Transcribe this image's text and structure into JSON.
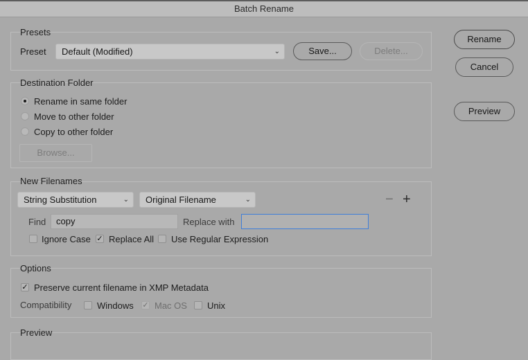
{
  "window": {
    "title": "Batch Rename"
  },
  "buttons": {
    "rename": "Rename",
    "cancel": "Cancel",
    "preview": "Preview"
  },
  "presets": {
    "legend": "Presets",
    "label": "Preset",
    "selected": "Default (Modified)",
    "save": "Save...",
    "delete": "Delete..."
  },
  "destination": {
    "legend": "Destination Folder",
    "options": [
      "Rename in same folder",
      "Move to other folder",
      "Copy to other folder"
    ],
    "selected_index": 0,
    "browse": "Browse..."
  },
  "new_filenames": {
    "legend": "New Filenames",
    "type_select": "String Substitution",
    "source_select": "Original Filename",
    "find_label": "Find",
    "find_value": "copy",
    "replace_label": "Replace with",
    "replace_value": "",
    "ignore_case": {
      "label": "Ignore Case",
      "checked": false
    },
    "replace_all": {
      "label": "Replace All",
      "checked": true
    },
    "regex": {
      "label": "Use Regular Expression",
      "checked": false
    },
    "remove_icon": "minus-icon",
    "add_icon": "plus-icon"
  },
  "options": {
    "legend": "Options",
    "preserve": {
      "label": "Preserve current filename in XMP Metadata",
      "checked": true
    },
    "compat_label": "Compatibility",
    "windows": {
      "label": "Windows",
      "checked": false
    },
    "macos": {
      "label": "Mac OS",
      "checked": true,
      "disabled": true
    },
    "unix": {
      "label": "Unix",
      "checked": false
    }
  },
  "preview": {
    "legend": "Preview"
  },
  "colors": {
    "background": "#a9a9a9",
    "focus_ring": "#3f7ed8"
  }
}
